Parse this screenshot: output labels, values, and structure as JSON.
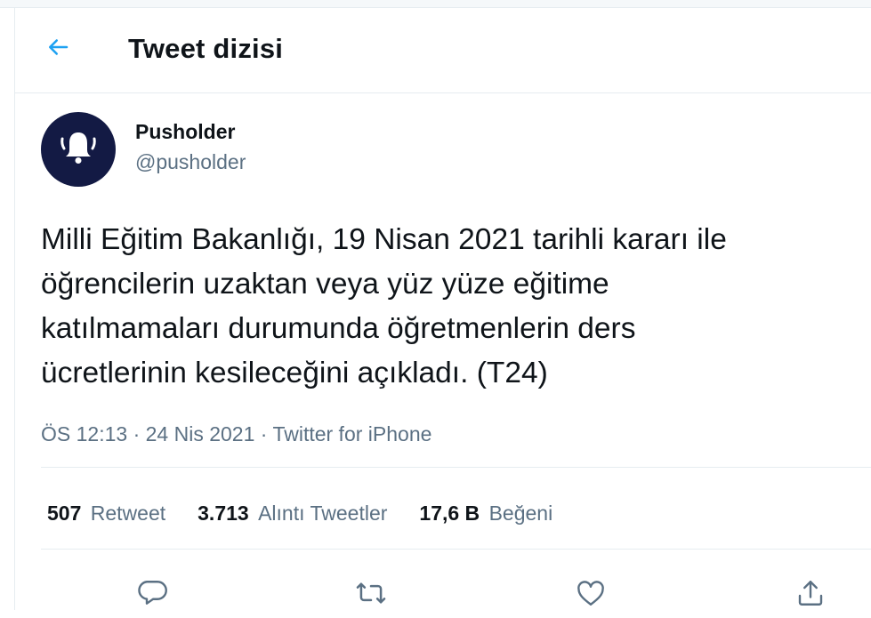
{
  "header": {
    "title": "Tweet dizisi",
    "back_icon": "arrow-left-icon",
    "accent_color": "#1da1f2"
  },
  "tweet": {
    "author": {
      "display_name": "Pusholder",
      "handle": "@pusholder",
      "avatar_icon": "bell-icon",
      "avatar_color": "#131a44"
    },
    "text": "Milli Eğitim Bakanlığı, 19 Nisan 2021 tarihli kararı ile\nöğrencilerin uzaktan veya yüz yüze eğitime\nkatılmamaları durumunda öğretmenlerin ders\nücretlerinin kesileceğini açıkladı. (T24)",
    "meta": {
      "time": "ÖS 12:13",
      "separator": "·",
      "date": "24 Nis 2021",
      "source": "Twitter for iPhone"
    },
    "stats": [
      {
        "count": "507",
        "label": "Retweet"
      },
      {
        "count": "3.713",
        "label": "Alıntı Tweetler"
      },
      {
        "count": "17,6 B",
        "label": "Beğeni"
      }
    ],
    "actions": [
      "reply-icon",
      "retweet-icon",
      "like-icon",
      "share-icon"
    ]
  }
}
